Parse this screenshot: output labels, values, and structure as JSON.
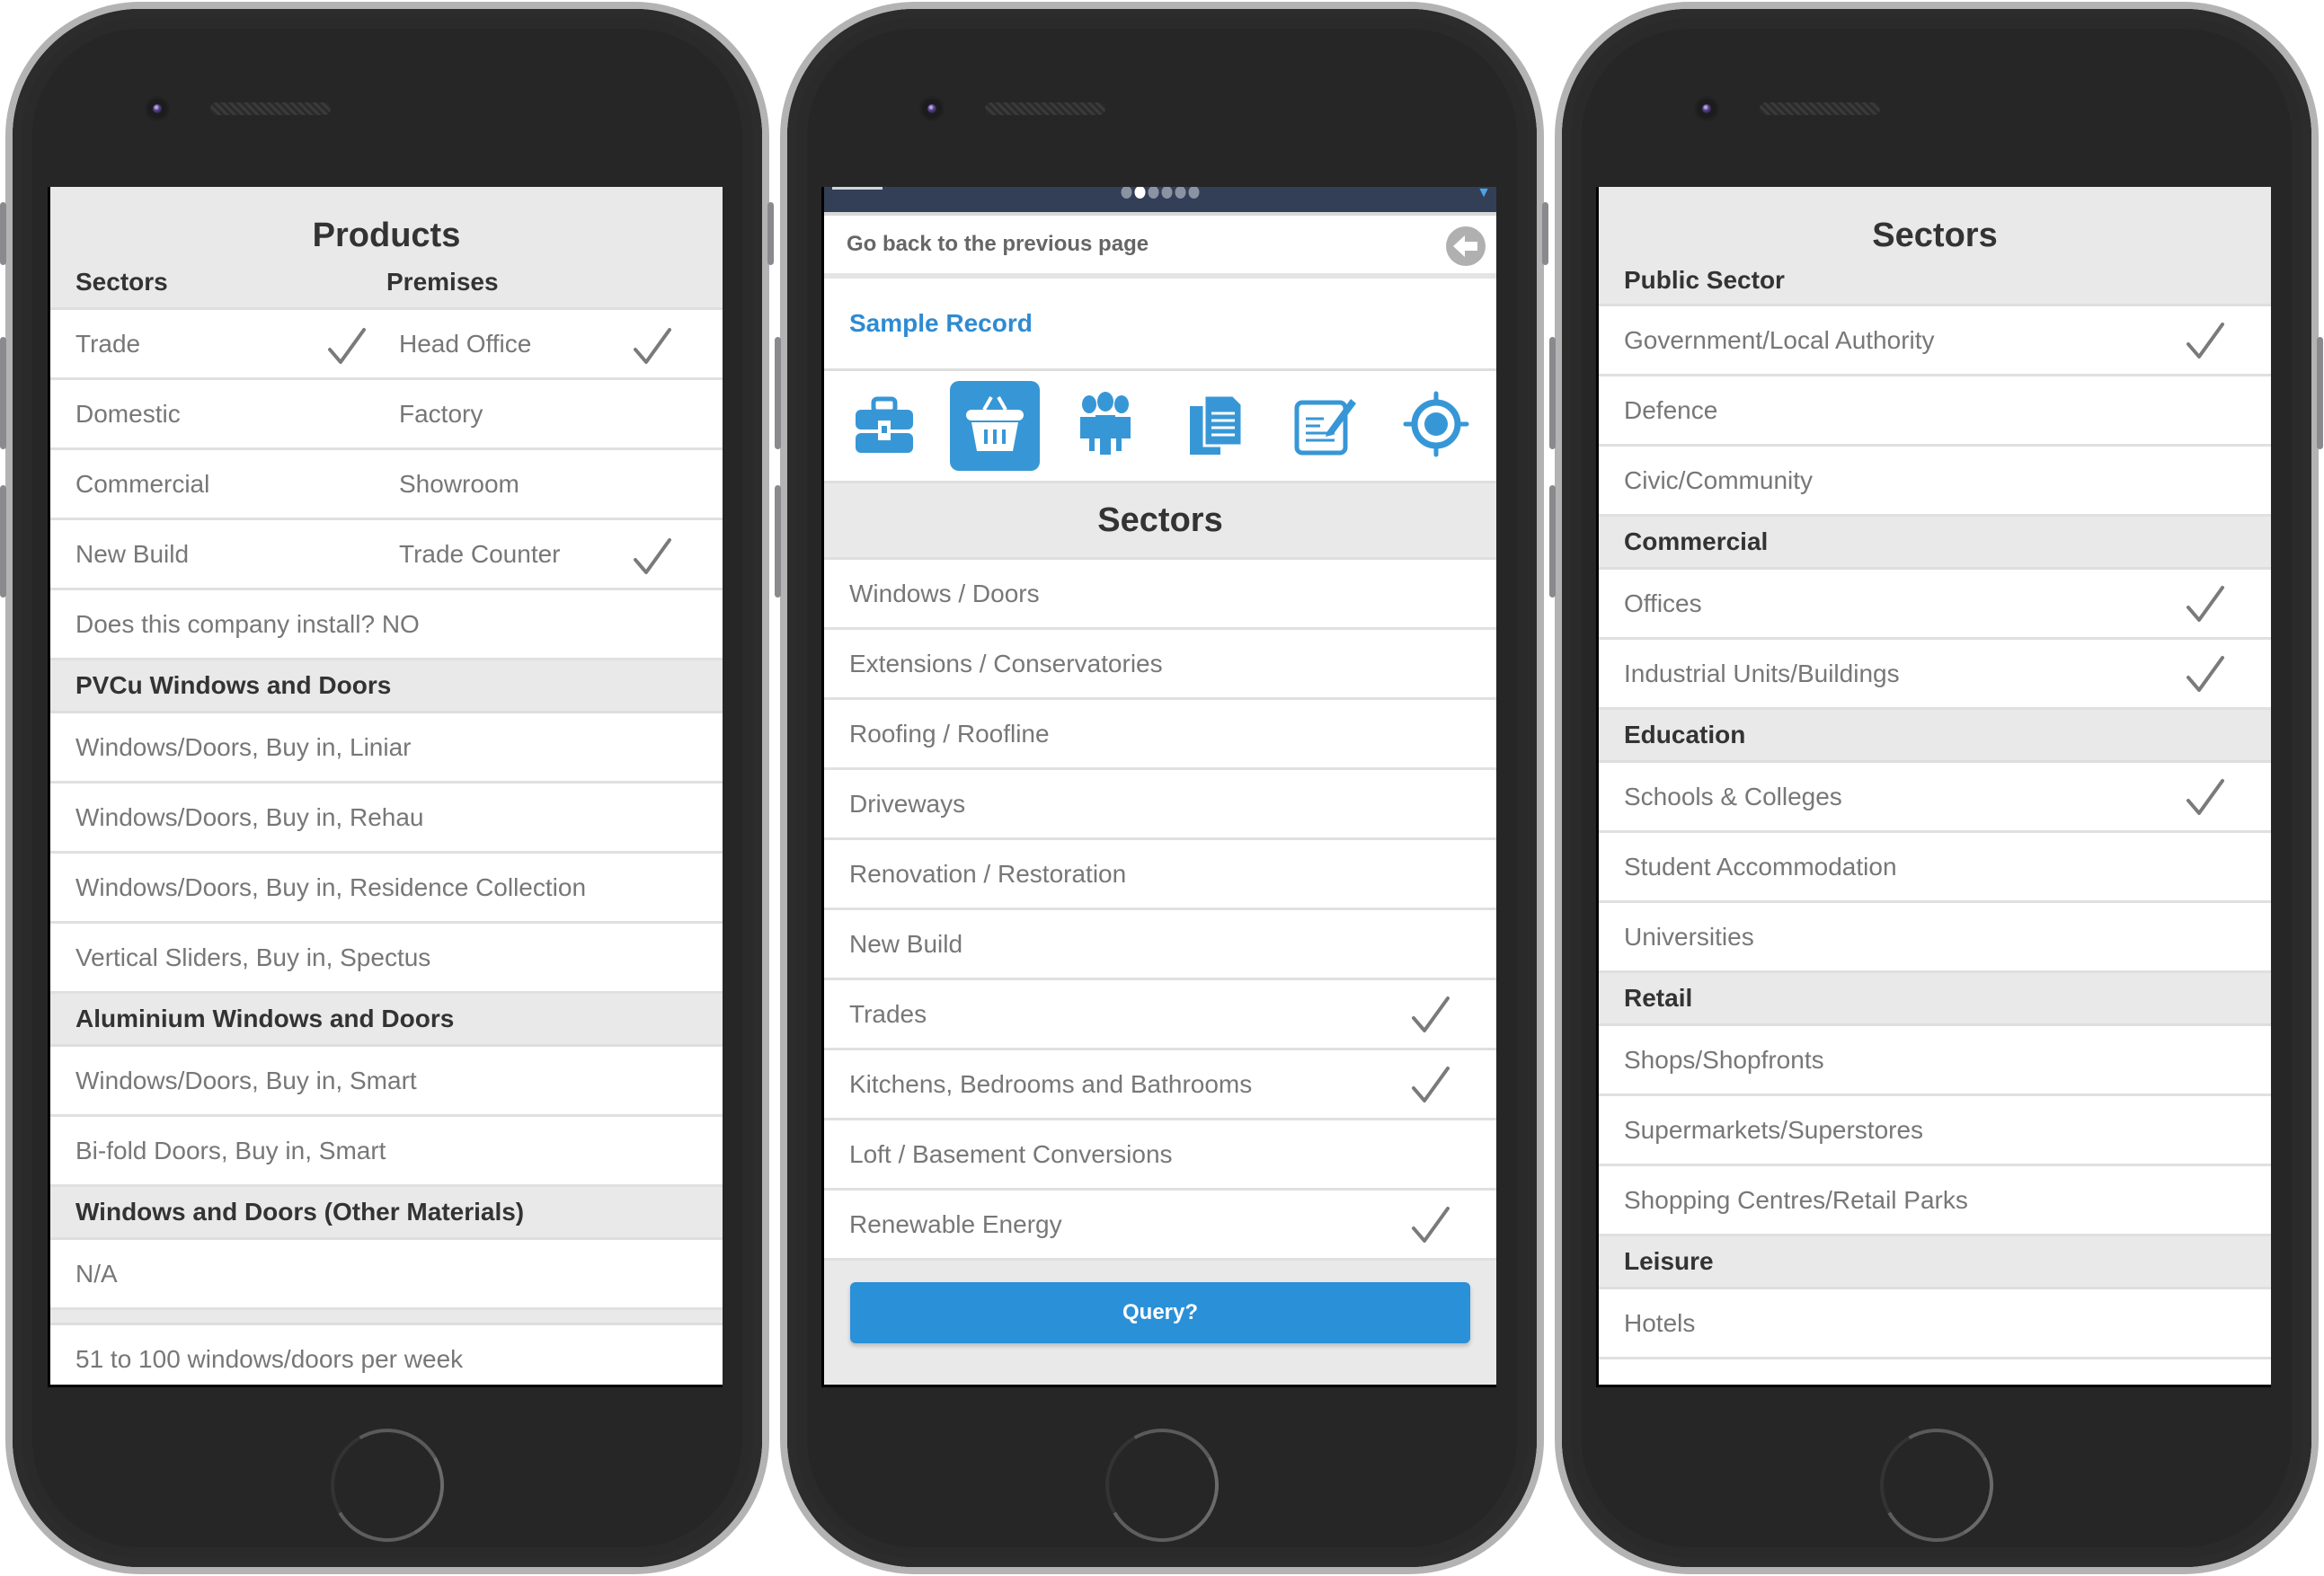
{
  "phones": {
    "products": {
      "title": "Products",
      "col_headers": [
        "Sectors",
        "Premises"
      ],
      "two_col_rows": [
        {
          "left": "Trade",
          "left_checked": true,
          "right": "Head Office",
          "right_checked": true
        },
        {
          "left": "Domestic",
          "left_checked": false,
          "right": "Factory",
          "right_checked": false
        },
        {
          "left": "Commercial",
          "left_checked": false,
          "right": "Showroom",
          "right_checked": false
        },
        {
          "left": "New Build",
          "left_checked": false,
          "right": "Trade Counter",
          "right_checked": true
        }
      ],
      "install_question": "Does this company install? NO",
      "groups": [
        {
          "header": "PVCu Windows and Doors",
          "items": [
            "Windows/Doors, Buy in, Liniar",
            "Windows/Doors, Buy in, Rehau",
            "Windows/Doors, Buy in, Residence Collection",
            "Vertical Sliders, Buy in, Spectus"
          ]
        },
        {
          "header": "Aluminium Windows and Doors",
          "items": [
            "Windows/Doors, Buy in, Smart",
            "Bi-fold Doors, Buy in, Smart"
          ]
        },
        {
          "header": "Windows and Doors (Other Materials)",
          "items": [
            "N/A"
          ]
        }
      ],
      "volume": "51 to 100 windows/doors per week"
    },
    "record": {
      "carousel": {
        "count": 6,
        "active_index": 1
      },
      "back_label": "Go back to the previous page",
      "record_name": "Sample Record",
      "icons": [
        {
          "name": "briefcase-icon",
          "active": false
        },
        {
          "name": "basket-icon",
          "active": true
        },
        {
          "name": "people-icon",
          "active": false
        },
        {
          "name": "documents-icon",
          "active": false
        },
        {
          "name": "edit-note-icon",
          "active": false
        },
        {
          "name": "target-icon",
          "active": false
        }
      ],
      "section_title": "Sectors",
      "items": [
        {
          "label": "Windows / Doors",
          "checked": false
        },
        {
          "label": "Extensions / Conservatories",
          "checked": false
        },
        {
          "label": "Roofing / Roofline",
          "checked": false
        },
        {
          "label": "Driveways",
          "checked": false
        },
        {
          "label": "Renovation / Restoration",
          "checked": false
        },
        {
          "label": "New Build",
          "checked": false
        },
        {
          "label": "Trades",
          "checked": true
        },
        {
          "label": "Kitchens, Bedrooms and Bathrooms",
          "checked": true
        },
        {
          "label": "Loft / Basement Conversions",
          "checked": false
        },
        {
          "label": "Renewable Energy",
          "checked": true
        }
      ],
      "query_button": "Query?"
    },
    "sectors": {
      "title": "Sectors",
      "groups": [
        {
          "header": "Public Sector",
          "items": [
            {
              "label": "Government/Local Authority",
              "checked": true
            },
            {
              "label": "Defence",
              "checked": false
            },
            {
              "label": "Civic/Community",
              "checked": false
            }
          ]
        },
        {
          "header": "Commercial",
          "items": [
            {
              "label": "Offices",
              "checked": true
            },
            {
              "label": "Industrial Units/Buildings",
              "checked": true
            }
          ]
        },
        {
          "header": "Education",
          "items": [
            {
              "label": "Schools & Colleges",
              "checked": true
            },
            {
              "label": "Student Accommodation",
              "checked": false
            },
            {
              "label": "Universities",
              "checked": false
            }
          ]
        },
        {
          "header": "Retail",
          "items": [
            {
              "label": "Shops/Shopfronts",
              "checked": false
            },
            {
              "label": "Supermarkets/Superstores",
              "checked": false
            },
            {
              "label": "Shopping Centres/Retail Parks",
              "checked": false
            }
          ]
        },
        {
          "header": "Leisure",
          "items": [
            {
              "label": "Hotels",
              "checked": false
            }
          ]
        }
      ]
    }
  },
  "colors": {
    "accent": "#2a90d8",
    "link": "#2e8bd2",
    "statusbar": "#333f57",
    "header_bg": "#e9e9e9",
    "text_muted": "#777777",
    "text_strong": "#333333"
  }
}
